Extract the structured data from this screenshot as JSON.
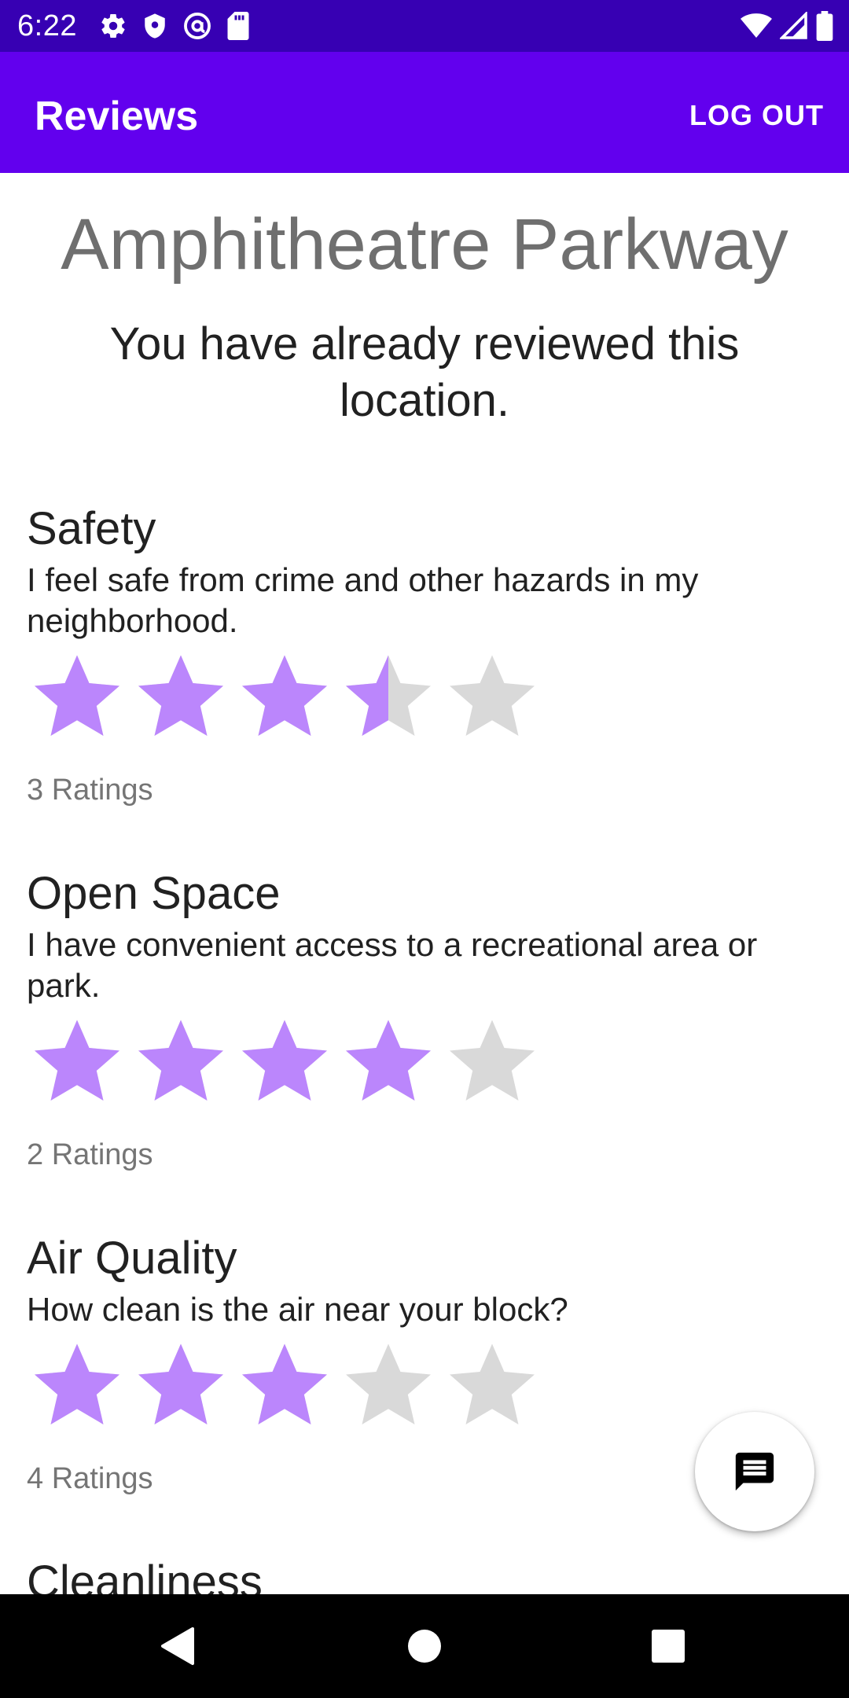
{
  "status_bar": {
    "time": "6:22",
    "left_icons": [
      "settings-icon",
      "shield-icon",
      "at-sign-icon",
      "sd-card-icon"
    ],
    "right_icons": [
      "wifi-icon",
      "cell-signal-icon",
      "battery-icon"
    ]
  },
  "app_bar": {
    "title": "Reviews",
    "logout_label": "LOG OUT",
    "color": "#6200ee",
    "status_color": "#3700b3"
  },
  "location": {
    "name": "Amphitheatre Parkway",
    "notice": "You have already reviewed this location."
  },
  "star_colors": {
    "filled": "#bb86fc",
    "empty": "#d9d9d9"
  },
  "categories": [
    {
      "title": "Safety",
      "question": "I feel safe from crime and other hazards in my neighborhood.",
      "rating": 3.5,
      "max_rating": 5,
      "count_label": "3 Ratings"
    },
    {
      "title": "Open Space",
      "question": "I have convenient access to a recreational area or park.",
      "rating": 4,
      "max_rating": 5,
      "count_label": "2 Ratings"
    },
    {
      "title": "Air Quality",
      "question": "How clean is the air near your block?",
      "rating": 3,
      "max_rating": 5,
      "count_label": "4 Ratings"
    },
    {
      "title": "Cleanliness"
    }
  ],
  "fab": {
    "icon": "chat-message-icon"
  },
  "nav_bar": {
    "icons": [
      "back-icon",
      "home-icon",
      "recents-icon"
    ]
  }
}
